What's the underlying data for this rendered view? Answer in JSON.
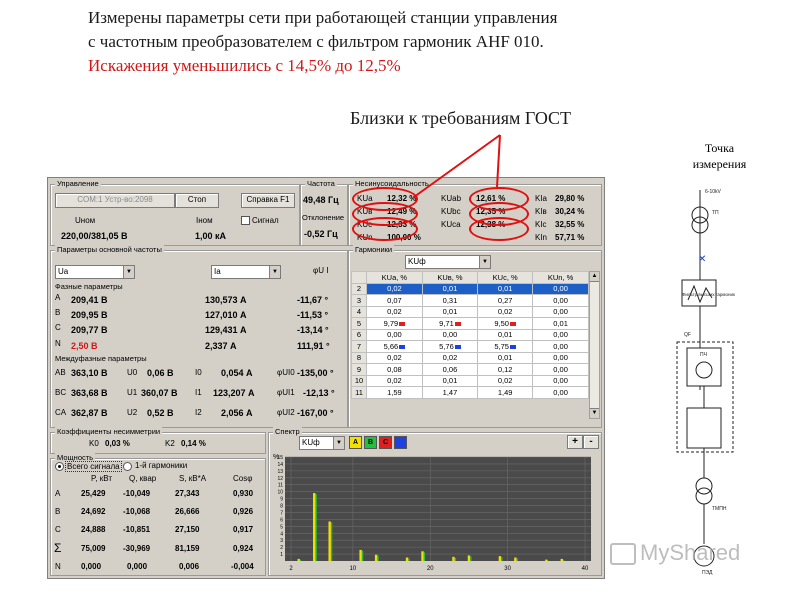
{
  "slide": {
    "line1": "Измерены параметры сети при работающей станции управления",
    "line2": "с частотным преобразователем с фильтром гармоник AHF 010.",
    "line3": "Искажения уменьшились с 14,5% до 12,5%",
    "gost": "Близки к требованиям ГОСТ",
    "measure_point_1": "Точка",
    "measure_point_2": "измерения",
    "watermark": "MyShared"
  },
  "control": {
    "title": "Управление",
    "port_button": "COM:1 Устр-во:2098",
    "stop_button": "Стоп",
    "help_button": "Справка F1",
    "unom_label": "Uном",
    "unom_value": "220,00/381,05 В",
    "inom_label": "Iном",
    "inom_value": "1,00 кА",
    "signal_label": "Сигнал"
  },
  "frequency": {
    "title": "Частота",
    "value": "49,48 Гц",
    "dev_label": "Отклонение",
    "dev_value": "-0,52 Гц"
  },
  "unbalance": {
    "title": "Несинусоидальность",
    "rows": [
      {
        "l1": "KUа",
        "v1": "12,32 %",
        "l2": "KUab",
        "v2": "12,61 %",
        "l3": "KIa",
        "v3": "29,80 %"
      },
      {
        "l1": "KUв",
        "v1": "12,49 %",
        "l2": "KUbc",
        "v2": "12,35 %",
        "l3": "KIв",
        "v3": "30,24 %"
      },
      {
        "l1": "KUc",
        "v1": "12,33 %",
        "l2": "KUca",
        "v2": "12,38 %",
        "l3": "KIc",
        "v3": "32,55 %"
      },
      {
        "l1": "KUn",
        "v1": "100,00 %",
        "l2": "",
        "v2": "",
        "l3": "KIn",
        "v3": "57,71 %"
      }
    ]
  },
  "basic": {
    "title": "Параметры основной частоты",
    "sel_u": "Ua",
    "sel_i": "Ia",
    "phi_label": "φU I"
  },
  "phase": {
    "title": "Фазные параметры",
    "rows": [
      {
        "ph": "A",
        "u": "209,41 В",
        "i": "130,573 А",
        "phi": "-11,67 °"
      },
      {
        "ph": "B",
        "u": "209,95 В",
        "i": "127,010 А",
        "phi": "-11,53 °"
      },
      {
        "ph": "C",
        "u": "209,77 В",
        "i": "129,431 А",
        "phi": "-13,14 °"
      },
      {
        "ph": "N",
        "u": "2,50 В",
        "i": "2,337 А",
        "phi": "111,91 °"
      }
    ]
  },
  "interphase": {
    "title": "Междуфазные параметры",
    "rows": [
      {
        "ph": "AB",
        "u": "363,10 В",
        "ul": "U0",
        "uv": "0,06 В",
        "il": "I0",
        "iv": "0,054 А",
        "pl": "φUI0",
        "pv": "-135,00 °"
      },
      {
        "ph": "BC",
        "u": "363,68 В",
        "ul": "U1",
        "uv": "360,07 В",
        "il": "I1",
        "iv": "123,207 А",
        "pl": "φUI1",
        "pv": "-12,13 °"
      },
      {
        "ph": "CA",
        "u": "362,87 В",
        "ul": "U2",
        "uv": "0,52 В",
        "il": "I2",
        "iv": "2,056 А",
        "pl": "φUI2",
        "pv": "-167,00 °"
      }
    ]
  },
  "asym": {
    "title": "Коэффициенты несимметрии",
    "k0_label": "K0",
    "k0_value": "0,03 %",
    "k2_label": "K2",
    "k2_value": "0,14 %"
  },
  "power": {
    "title": "Мощность",
    "radio1": "Всего сигнала",
    "radio2": "1-й гармоники",
    "headers": [
      "P, кВт",
      "Q, квар",
      "S, кВ*А",
      "Cosφ"
    ],
    "rows": [
      {
        "ph": "A",
        "p": "25,429",
        "q": "-10,049",
        "s": "27,343",
        "c": "0,930"
      },
      {
        "ph": "B",
        "p": "24,692",
        "q": "-10,068",
        "s": "26,666",
        "c": "0,926"
      },
      {
        "ph": "C",
        "p": "24,888",
        "q": "-10,851",
        "s": "27,150",
        "c": "0,917"
      },
      {
        "ph": "Σ",
        "p": "75,009",
        "q": "-30,969",
        "s": "81,159",
        "c": "0,924"
      },
      {
        "ph": "N",
        "p": "0,000",
        "q": "0,000",
        "s": "0,006",
        "c": "-0,004"
      }
    ]
  },
  "harmonics": {
    "title": "Гармоники",
    "select": "KUф",
    "headers": [
      "",
      "KUa, %",
      "KUв, %",
      "KUс, %",
      "KUn, %"
    ],
    "rows": [
      [
        "2",
        "0,02",
        "0,01",
        "0,01",
        "0,00"
      ],
      [
        "3",
        "0,07",
        "0,31",
        "0,27",
        "0,00"
      ],
      [
        "4",
        "0,02",
        "0,01",
        "0,02",
        "0,00"
      ],
      [
        "5",
        "9,79",
        "9,71",
        "9,50",
        "0,01"
      ],
      [
        "6",
        "0,00",
        "0,00",
        "0,01",
        "0,00"
      ],
      [
        "7",
        "5,66",
        "5,76",
        "5,75",
        "0,00"
      ],
      [
        "8",
        "0,02",
        "0,02",
        "0,01",
        "0,00"
      ],
      [
        "9",
        "0,08",
        "0,06",
        "0,12",
        "0,00"
      ],
      [
        "10",
        "0,02",
        "0,01",
        "0,02",
        "0,00"
      ],
      [
        "11",
        "1,59",
        "1,47",
        "1,49",
        "0,00"
      ]
    ]
  },
  "spectrum": {
    "title": "Спектр",
    "select": "KUф",
    "btn_a": "A",
    "btn_b": "B",
    "btn_c": "C",
    "plus": "+",
    "minus": "-",
    "y_unit": "%",
    "colors": {
      "a": "#f2e000",
      "b": "#22c040",
      "c": "#e02020",
      "n": "#2040e0"
    }
  },
  "chart_data": {
    "type": "bar",
    "x_ticks": [
      2,
      10,
      20,
      30,
      40
    ],
    "y_ticks": [
      15,
      14,
      13,
      12,
      11,
      10,
      9,
      8,
      7,
      6,
      5,
      4,
      3,
      2,
      1
    ],
    "xlim": [
      2,
      40
    ],
    "ylim": [
      0,
      15
    ],
    "x": [
      3,
      5,
      7,
      11,
      13,
      17,
      19,
      23,
      25,
      29,
      31,
      35,
      37
    ],
    "values": [
      0.3,
      9.8,
      5.7,
      1.6,
      0.9,
      0.5,
      1.4,
      0.6,
      0.8,
      0.7,
      0.5,
      0.2,
      0.3
    ]
  },
  "scheme": {
    "label_top": "6-10kV",
    "label_tp": "ТП",
    "label_filter": "Фильтр высших гармоник",
    "label_qf": "QF",
    "label_pch": "ПЧ",
    "label_tmpn": "ТМПН",
    "label_ped": "ПЭД"
  }
}
